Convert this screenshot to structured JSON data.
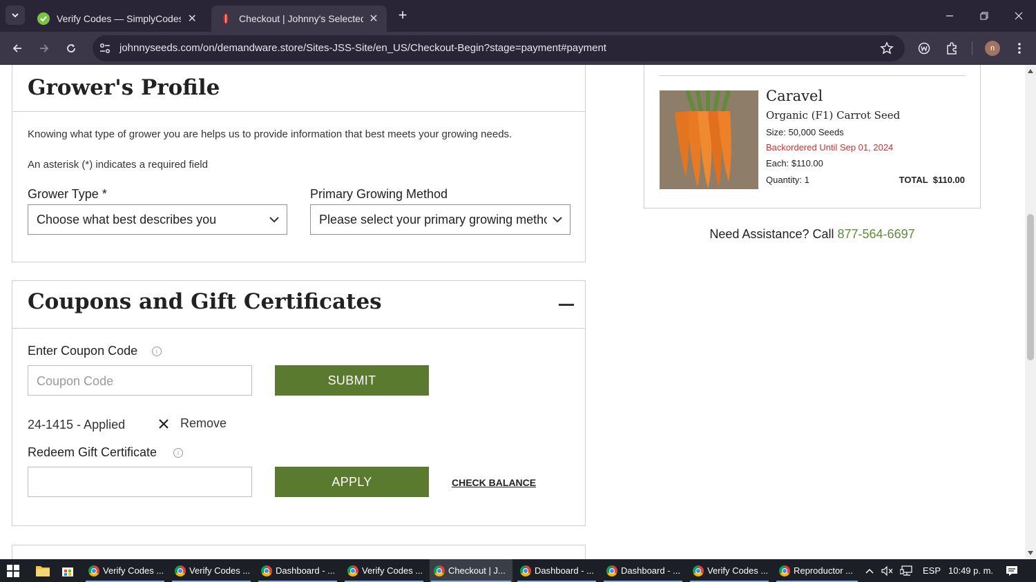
{
  "browser": {
    "tabs": [
      {
        "title": "Verify Codes — SimplyCodes",
        "active": false
      },
      {
        "title": "Checkout | Johnny's Selected Se",
        "active": true
      }
    ],
    "url": "johnnyseeds.com/on/demandware.store/Sites-JSS-Site/en_US/Checkout-Begin?stage=payment#payment",
    "profile_initial": "n"
  },
  "grower_profile": {
    "title": "Grower's Profile",
    "intro": "Knowing what type of grower you are helps us to provide information that best meets your growing needs.",
    "required_note": "An asterisk (*) indicates a required field",
    "grower_type_label": "Grower Type *",
    "grower_type_value": "Choose what best describes you",
    "growing_method_label": "Primary Growing Method",
    "growing_method_value": "Please select your primary growing method"
  },
  "coupons": {
    "title": "Coupons and Gift Certificates",
    "coupon_label": "Enter Coupon Code",
    "coupon_placeholder": "Coupon Code",
    "submit_label": "SUBMIT",
    "applied_text": "24-1415 - Applied",
    "remove_label": "Remove",
    "gift_label": "Redeem Gift Certificate",
    "gift_value": "",
    "apply_label": "APPLY",
    "check_balance_label": "CHECK BALANCE"
  },
  "order_item": {
    "name": "Caravel",
    "subtitle": "Organic (F1) Carrot Seed",
    "size": "Size: 50,000 Seeds",
    "backorder": "Backordered Until Sep 01, 2024",
    "each": "Each: $110.00",
    "quantity": "Quantity: 1",
    "total": "TOTAL  $110.00"
  },
  "assistance": {
    "text": "Need Assistance? Call ",
    "phone": "877-564-6697"
  },
  "taskbar": {
    "items": [
      {
        "label": "Verify Codes ..."
      },
      {
        "label": "Verify Codes ..."
      },
      {
        "label": "Dashboard - ..."
      },
      {
        "label": "Verify Codes ..."
      },
      {
        "label": "Checkout | J..."
      },
      {
        "label": "Dashboard - ..."
      },
      {
        "label": "Dashboard - ..."
      },
      {
        "label": "Verify Codes ..."
      },
      {
        "label": "Reproductor ..."
      }
    ],
    "language": "ESP",
    "clock": "10:49 p. m."
  },
  "colors": {
    "accent_green": "#5a7a2f",
    "phone_green": "#5f8a3a",
    "backorder_red": "#d0312d",
    "chrome_dark": "#2a2536"
  }
}
